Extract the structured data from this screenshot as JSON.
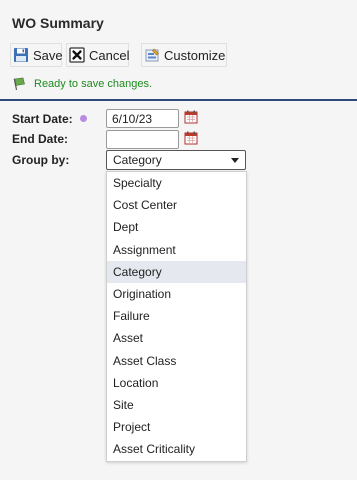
{
  "window": {
    "title": "WO Summary"
  },
  "toolbar": {
    "save_label": "Save",
    "cancel_label": "Cancel",
    "customize_label": "Customize"
  },
  "status": {
    "message": "Ready to save changes.",
    "color": "#1f8a1f"
  },
  "form": {
    "start_date": {
      "label": "Start Date:",
      "value": "6/10/23"
    },
    "end_date": {
      "label": "End Date:",
      "value": ""
    },
    "group_by": {
      "label": "Group by:",
      "selected": "Category",
      "options": [
        "Specialty",
        "Cost Center",
        "Dept",
        "Assignment",
        "Category",
        "Origination",
        "Failure",
        "Asset",
        "Asset Class",
        "Location",
        "Site",
        "Project",
        "Asset Criticality"
      ]
    }
  },
  "icons": {
    "save": "floppy-disk-icon",
    "cancel": "x-box-icon",
    "customize": "customize-icon",
    "status": "flag-icon",
    "calendar": "calendar-icon",
    "required": "required-dot"
  },
  "colors": {
    "rule": "#2d4a78",
    "required_dot": "#b98be0",
    "highlight": "#e6e8ef"
  }
}
